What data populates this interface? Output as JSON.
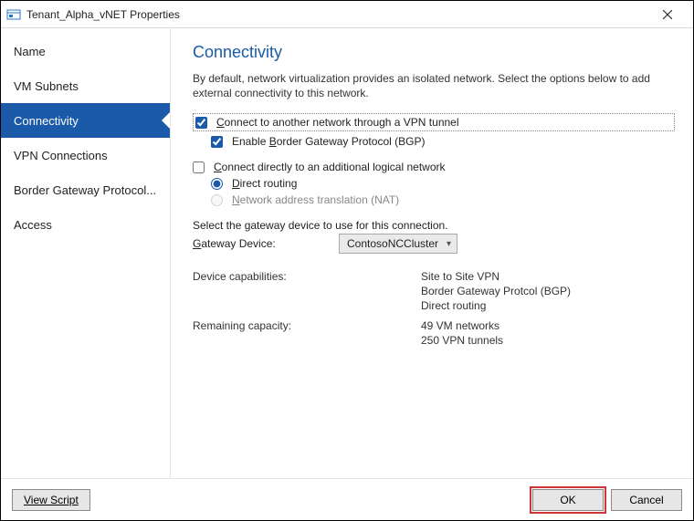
{
  "window": {
    "title": "Tenant_Alpha_vNET Properties"
  },
  "sidebar": {
    "items": [
      {
        "label": "Name"
      },
      {
        "label": "VM Subnets"
      },
      {
        "label": "Connectivity",
        "selected": true
      },
      {
        "label": "VPN Connections"
      },
      {
        "label": "Border Gateway Protocol..."
      },
      {
        "label": "Access"
      }
    ]
  },
  "main": {
    "heading": "Connectivity",
    "intro": "By default, network virtualization provides an isolated network. Select the options below to add external connectivity to this network.",
    "vpn_tunnel": {
      "checked": true,
      "label_pre": "C",
      "label_rest": "onnect to another network through a VPN tunnel"
    },
    "bgp": {
      "checked": true,
      "label_pre": "Enable ",
      "label_u": "B",
      "label_rest": "order Gateway Protocol (BGP)"
    },
    "direct_logical": {
      "checked": false,
      "label_pre": "C",
      "label_rest": "onnect directly to an additional logical network"
    },
    "direct_routing": {
      "checked": true,
      "label_u": "D",
      "label_rest": "irect routing"
    },
    "nat": {
      "checked": false,
      "label_u": "N",
      "label_rest": "etwork address translation (NAT)"
    },
    "gateway_prompt": "Select the gateway device to use for this connection.",
    "gateway_label_u": "G",
    "gateway_label_rest": "ateway Device:",
    "gateway_selected": "ContosoNCCluster",
    "capabilities_label": "Device capabilities:",
    "capabilities": [
      "Site to Site VPN",
      "Border Gateway Protcol (BGP)",
      "Direct routing"
    ],
    "remaining_label": "Remaining capacity:",
    "remaining": [
      "49 VM networks",
      "250 VPN tunnels"
    ]
  },
  "footer": {
    "view_script": "View Script",
    "ok": "OK",
    "cancel": "Cancel"
  }
}
